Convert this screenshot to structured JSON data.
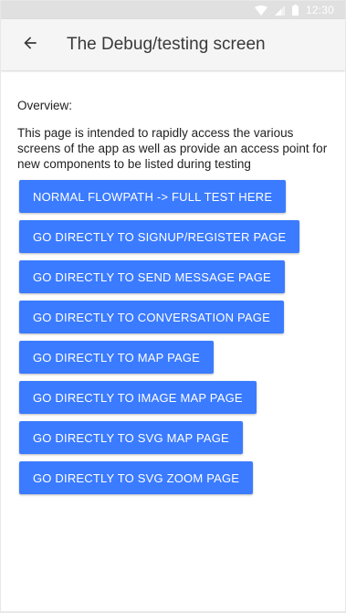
{
  "status_bar": {
    "time": "12:30",
    "icons": [
      "wifi-icon",
      "signal-icon",
      "battery-icon"
    ]
  },
  "app_bar": {
    "back_icon": "arrow-back-icon",
    "title": "The Debug/testing screen"
  },
  "content": {
    "overview_label": "Overview:",
    "description": "This page is intended to rapidly access the various screens of the app as well as provide an access point for new components to be listed during testing"
  },
  "buttons": [
    {
      "label": "NORMAL FLOWPATH -> FULL TEST HERE"
    },
    {
      "label": "GO DIRECTLY TO SIGNUP/REGISTER PAGE"
    },
    {
      "label": "GO DIRECTLY TO SEND MESSAGE PAGE"
    },
    {
      "label": "GO DIRECTLY TO CONVERSATION PAGE"
    },
    {
      "label": "GO DIRECTLY TO MAP PAGE"
    },
    {
      "label": "GO DIRECTLY TO IMAGE MAP PAGE"
    },
    {
      "label": "GO DIRECTLY TO SVG MAP PAGE"
    },
    {
      "label": "GO DIRECTLY TO SVG ZOOM PAGE"
    }
  ],
  "colors": {
    "button": "#3b7bff",
    "app_bar": "#f5f5f5",
    "status_bar": "#e0e0e0"
  }
}
